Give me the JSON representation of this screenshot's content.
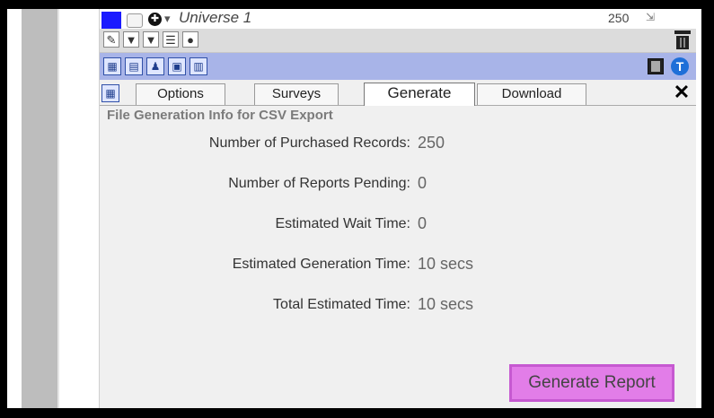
{
  "header": {
    "universe_title": "Universe 1",
    "record_count": "250",
    "globe_glyph": "✚",
    "caret_glyph": "▾"
  },
  "toolbar": {
    "tools": [
      {
        "name": "pencil-icon",
        "glyph": "✎"
      },
      {
        "name": "funnel-icon",
        "glyph": "▼"
      },
      {
        "name": "funnel-check-icon",
        "glyph": "▼"
      },
      {
        "name": "document-icon",
        "glyph": "☰"
      },
      {
        "name": "user-icon",
        "glyph": "●"
      }
    ]
  },
  "blue_bar": {
    "icons": [
      "report-icon",
      "table-icon",
      "person-report-icon",
      "export-icon",
      "building-icon"
    ],
    "info_glyph": "T"
  },
  "tabs": {
    "home_glyph": "▦",
    "options": "Options",
    "surveys": "Surveys",
    "generate": "Generate",
    "download": "Download",
    "close_glyph": "✕",
    "active": "generate"
  },
  "generate_panel": {
    "section_title": "File Generation Info for CSV Export",
    "rows": [
      {
        "label": "Number of Purchased Records:",
        "value": "250"
      },
      {
        "label": "Number of Reports Pending:",
        "value": "0"
      },
      {
        "label": "Estimated Wait Time:",
        "value": "0"
      },
      {
        "label": "Estimated Generation Time:",
        "value": "10 secs"
      },
      {
        "label": "Total Estimated Time:",
        "value": "10 secs"
      }
    ],
    "button_label": "Generate Report"
  },
  "colors": {
    "swatch": "#1a1aff",
    "blue_bar": "#a8b4e8",
    "button_fill": "#e27de8",
    "button_border": "#c659d1",
    "section_title": "#7b7b7b"
  }
}
